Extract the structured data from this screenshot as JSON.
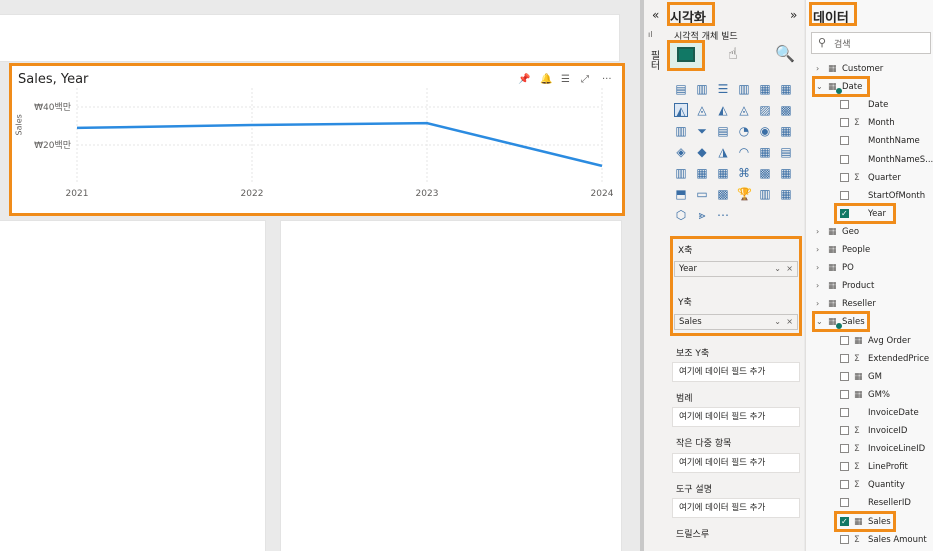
{
  "visual": {
    "title": "Sales, Year",
    "y_axis_label": "Sales",
    "header_icons": [
      "pin-icon",
      "bell-icon",
      "filter-icon",
      "focus-mode-icon",
      "more-options-icon"
    ]
  },
  "chart_data": {
    "type": "line",
    "title": "Sales, Year",
    "xlabel": "",
    "ylabel": "Sales",
    "categories": [
      "2021",
      "2022",
      "2023",
      "2024"
    ],
    "y_ticks": [
      "₩40백만",
      "₩20백만"
    ],
    "ylim": [
      0,
      50
    ],
    "values": [
      29,
      30.5,
      31.5,
      9
    ],
    "grid": true,
    "colors": {
      "line": "#2b8be0"
    }
  },
  "viz_pane": {
    "collapse_glyph": "«",
    "title": "시각화",
    "expand_glyph": "»",
    "subtitle": "시각적 개체 빌드",
    "tabs": [
      "build-visual-icon",
      "format-visual-icon",
      "analytics-icon"
    ],
    "wells": {
      "x_axis": {
        "label": "X축",
        "field": "Year"
      },
      "y_axis": {
        "label": "Y축",
        "field": "Sales"
      },
      "secondary_y": {
        "label": "보조 Y축",
        "placeholder": "여기에 데이터 필드 추가"
      },
      "legend": {
        "label": "범례",
        "placeholder": "여기에 데이터 필드 추가"
      },
      "small_multiples": {
        "label": "작은 다중 항목",
        "placeholder": "여기에 데이터 필드 추가"
      },
      "tooltips": {
        "label": "도구 설명",
        "placeholder": "여기에 데이터 필드 추가"
      },
      "drillthrough": {
        "label": "드릴스루"
      }
    },
    "side_label": "필터"
  },
  "data_pane": {
    "title": "데이터",
    "search_placeholder": "검색",
    "tables": [
      {
        "name": "Customer",
        "expanded": false
      },
      {
        "name": "Date",
        "expanded": true,
        "fields": [
          {
            "name": "Date",
            "sigma": false,
            "checked": false
          },
          {
            "name": "Month",
            "sigma": true,
            "checked": false
          },
          {
            "name": "MonthName",
            "sigma": false,
            "checked": false
          },
          {
            "name": "MonthNameS...",
            "sigma": false,
            "checked": false
          },
          {
            "name": "Quarter",
            "sigma": true,
            "checked": false
          },
          {
            "name": "StartOfMonth",
            "sigma": false,
            "checked": false
          },
          {
            "name": "Year",
            "sigma": false,
            "checked": true
          }
        ]
      },
      {
        "name": "Geo",
        "expanded": false
      },
      {
        "name": "People",
        "expanded": false
      },
      {
        "name": "PO",
        "expanded": false
      },
      {
        "name": "Product",
        "expanded": false
      },
      {
        "name": "Reseller",
        "expanded": false
      },
      {
        "name": "Sales",
        "expanded": true,
        "fields": [
          {
            "name": "Avg Order",
            "sigma": false,
            "measure": true,
            "checked": false
          },
          {
            "name": "ExtendedPrice",
            "sigma": true,
            "checked": false
          },
          {
            "name": "GM",
            "sigma": false,
            "measure": true,
            "checked": false
          },
          {
            "name": "GM%",
            "sigma": false,
            "measure": true,
            "checked": false
          },
          {
            "name": "InvoiceDate",
            "sigma": false,
            "checked": false
          },
          {
            "name": "InvoiceID",
            "sigma": true,
            "checked": false
          },
          {
            "name": "InvoiceLineID",
            "sigma": true,
            "checked": false
          },
          {
            "name": "LineProfit",
            "sigma": true,
            "checked": false
          },
          {
            "name": "Quantity",
            "sigma": true,
            "checked": false
          },
          {
            "name": "ResellerID",
            "sigma": false,
            "checked": false
          },
          {
            "name": "Sales",
            "sigma": false,
            "measure": true,
            "checked": true
          },
          {
            "name": "Sales Amount",
            "sigma": true,
            "checked": false
          }
        ]
      }
    ]
  }
}
